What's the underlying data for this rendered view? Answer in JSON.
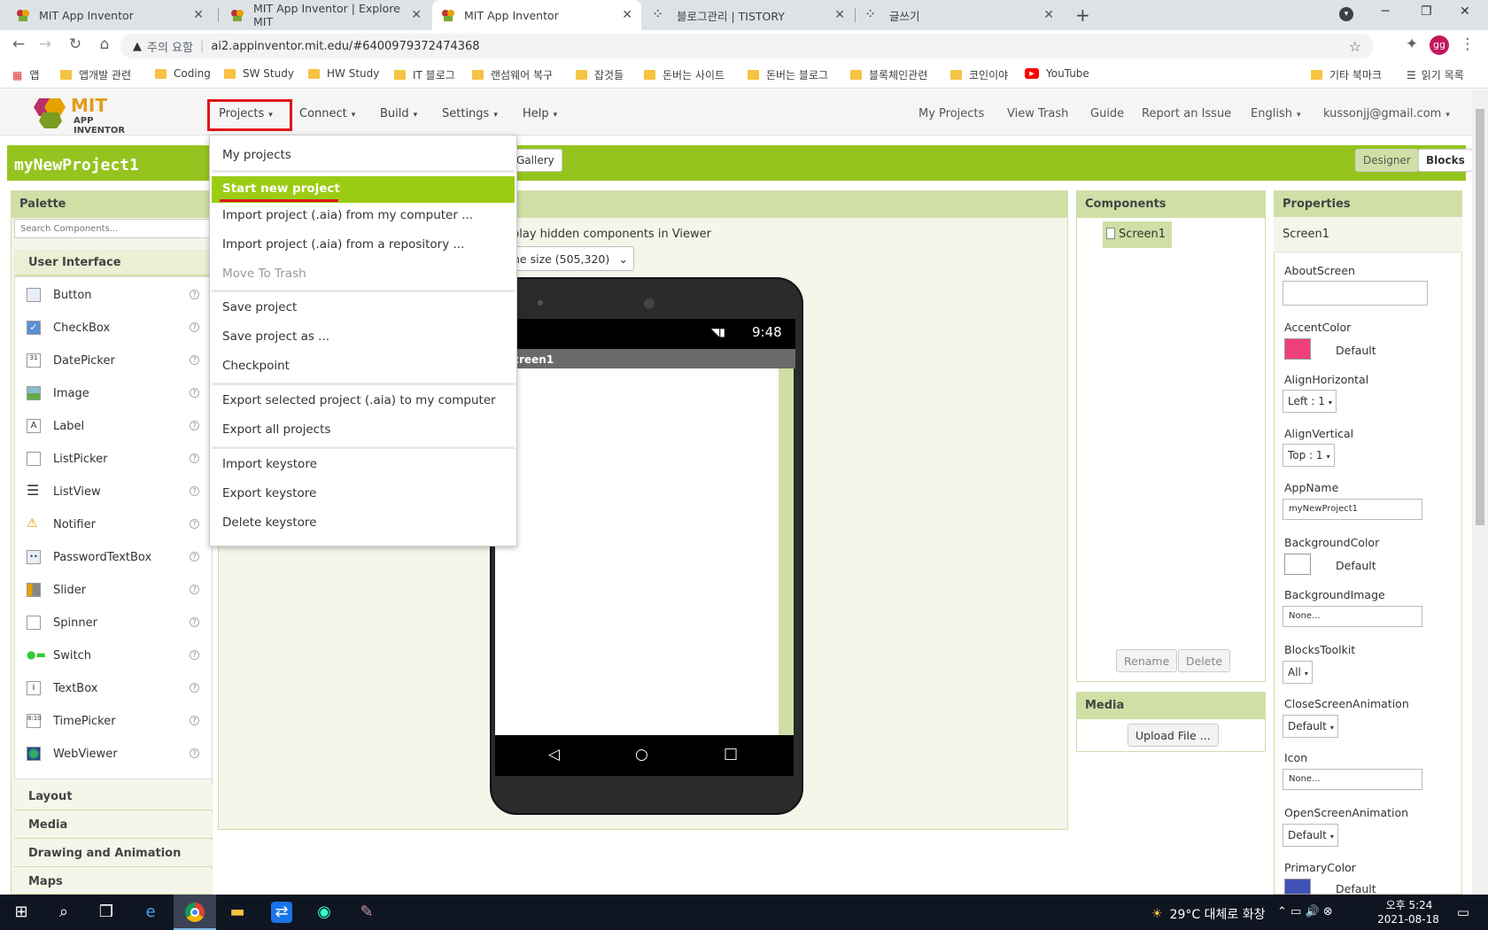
{
  "browser": {
    "tabs": [
      {
        "title": "MIT App Inventor",
        "active": false
      },
      {
        "title": "MIT App Inventor | Explore MIT",
        "active": false
      },
      {
        "title": "MIT App Inventor",
        "active": true
      },
      {
        "title": "블로그관리 | TISTORY",
        "active": false
      },
      {
        "title": "글쓰기",
        "active": false
      }
    ],
    "security_label": "주의 요함",
    "url": "ai2.appinventor.mit.edu/#6400979372474368",
    "profile_initials": "gg",
    "bookmarks": [
      "앱",
      "앱개발 관련",
      "Coding",
      "SW Study",
      "HW Study",
      "IT 블로그",
      "랜섬웨어 복구",
      "잡것들",
      "돈버는 사이트",
      "돈버는 블로그",
      "블록체인관련",
      "코인이야",
      "YouTube"
    ],
    "other_bookmarks": "기타 북마크",
    "reading_list": "읽기 목록"
  },
  "app": {
    "logo_main": "MIT",
    "logo_sub": "APP INVENTOR",
    "menus": [
      "Projects",
      "Connect",
      "Build",
      "Settings",
      "Help"
    ],
    "right_menus": [
      "My Projects",
      "View Trash",
      "Guide",
      "Report an Issue",
      "English",
      "kussonjj@gmail.com"
    ],
    "project_name": "myNewProject1",
    "gallery_btn": "Gallery",
    "designer_btn": "Designer",
    "blocks_btn": "Blocks"
  },
  "projects_menu": {
    "items": [
      "My projects",
      "Start new project",
      "Import project (.aia) from my computer ...",
      "Import project (.aia) from a repository ...",
      "Move To Trash",
      "Save project",
      "Save project as ...",
      "Checkpoint",
      "Export selected project (.aia) to my computer",
      "Export all projects",
      "Import keystore",
      "Export keystore",
      "Delete keystore"
    ],
    "highlighted": "Start new project",
    "disabled": "Move To Trash"
  },
  "palette": {
    "title": "Palette",
    "search_placeholder": "Search Components...",
    "category": "User Interface",
    "items": [
      "Button",
      "CheckBox",
      "DatePicker",
      "Image",
      "Label",
      "ListPicker",
      "ListView",
      "Notifier",
      "PasswordTextBox",
      "Slider",
      "Spinner",
      "Switch",
      "TextBox",
      "TimePicker",
      "WebViewer"
    ],
    "sections": [
      "Layout",
      "Media",
      "Drawing and Animation",
      "Maps"
    ]
  },
  "viewer": {
    "hidden_label": "play hidden components in Viewer",
    "size_select": "ne size (505,320)",
    "phone_time": "9:48",
    "screen_title": "creen1"
  },
  "components": {
    "title": "Components",
    "tree_item": "Screen1",
    "rename": "Rename",
    "delete": "Delete"
  },
  "media": {
    "title": "Media",
    "upload": "Upload File ..."
  },
  "properties": {
    "title": "Properties",
    "component": "Screen1",
    "about_label": "AboutScreen",
    "accent_label": "AccentColor",
    "accent_value": "Default",
    "accent_color": "#f0407a",
    "alignh_label": "AlignHorizontal",
    "alignh_value": "Left : 1",
    "alignv_label": "AlignVertical",
    "alignv_value": "Top : 1",
    "appname_label": "AppName",
    "appname_value": "myNewProject1",
    "bgcolor_label": "BackgroundColor",
    "bgcolor_value": "Default",
    "bgimage_label": "BackgroundImage",
    "bgimage_value": "None...",
    "toolkit_label": "BlocksToolkit",
    "toolkit_value": "All",
    "closeanim_label": "CloseScreenAnimation",
    "closeanim_value": "Default",
    "icon_label": "Icon",
    "icon_value": "None...",
    "openanim_label": "OpenScreenAnimation",
    "openanim_value": "Default",
    "primary_label": "PrimaryColor",
    "primary_value": "Default",
    "primary_color": "#3f51b5"
  },
  "taskbar": {
    "weather": "29°C 대체로 화창",
    "time": "오후 5:24",
    "date": "2021-08-18"
  },
  "colors": {
    "accent_green": "#95c41f",
    "highlight_green": "#9bcc14",
    "annotation_red": "#e0161b"
  }
}
